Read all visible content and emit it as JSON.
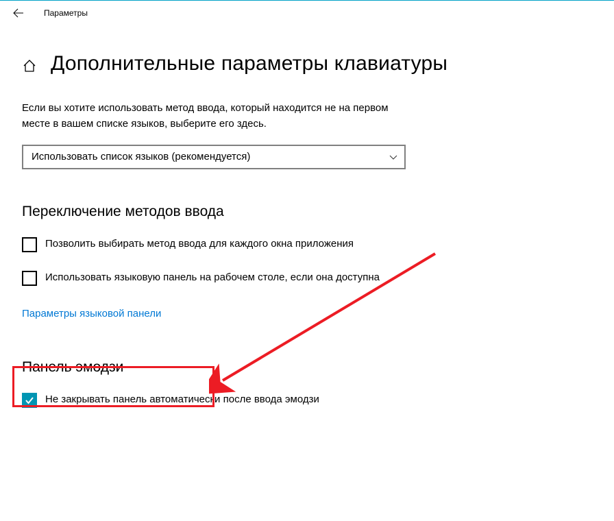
{
  "titlebar": {
    "title": "Параметры"
  },
  "page": {
    "heading": "Дополнительные параметры клавиатуры",
    "description": "Если вы хотите использовать метод ввода, который находится не на первом месте в вашем списке языков, выберите его здесь."
  },
  "dropdown": {
    "selected": "Использовать список языков (рекомендуется)"
  },
  "sections": {
    "switching": {
      "heading": "Переключение методов ввода",
      "checkbox1": "Позволить выбирать метод ввода для каждого окна приложения",
      "checkbox2": "Использовать языковую панель на рабочем столе, если она доступна",
      "link": "Параметры языковой панели"
    },
    "emoji": {
      "heading": "Панель эмодзи",
      "checkbox": "Не закрывать панель автоматически после ввода эмодзи"
    }
  }
}
